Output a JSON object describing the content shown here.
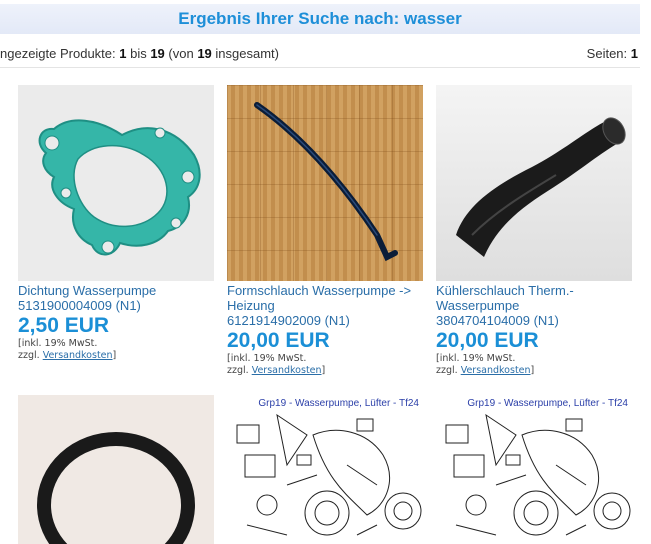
{
  "header": {
    "title": "Ergebnis Ihrer Suche nach: wasser"
  },
  "meta": {
    "prefix": "ngezeigte Produkte: ",
    "from": "1",
    "sep1": " bis ",
    "to": "19",
    "sep2": " (von ",
    "total": "19",
    "suffix": " insgesamt)",
    "pages_label": "Seiten: ",
    "pages_value": "1"
  },
  "products": [
    {
      "image": "gasket-image",
      "title_lines": [
        "Dichtung Wasserpumpe",
        "5131900004009 (N1)"
      ],
      "price": "2,50 EUR",
      "tax_line1": "[inkl. 19% MwSt.",
      "tax_line2_prefix": "zzgl. ",
      "shipping_link": "Versandkosten",
      "tax_line2_suffix": "]"
    },
    {
      "image": "hose-on-parquet-image",
      "title_lines": [
        "Formschlauch Wasserpumpe ->",
        "Heizung",
        "6121914902009 (N1)"
      ],
      "price": "20,00 EUR",
      "tax_line1": "[inkl. 19% MwSt.",
      "tax_line2_prefix": "zzgl. ",
      "shipping_link": "Versandkosten",
      "tax_line2_suffix": "]"
    },
    {
      "image": "cooler-hose-image",
      "title_lines": [
        "Kühlerschlauch Therm.-",
        "Wasserpumpe",
        "3804704104009 (N1)"
      ],
      "price": "20,00 EUR",
      "tax_line1": "[inkl. 19% MwSt.",
      "tax_line2_prefix": "zzgl. ",
      "shipping_link": "Versandkosten",
      "tax_line2_suffix": "]"
    },
    {
      "image": "o-ring-image"
    },
    {
      "image": "exploded-diagram-image",
      "diagram_title": "Grp19 - Wasserpumpe, Lüfter - Tf24"
    },
    {
      "image": "exploded-diagram-image",
      "diagram_title": "Grp19 - Wasserpumpe, Lüfter - Tf24"
    }
  ]
}
